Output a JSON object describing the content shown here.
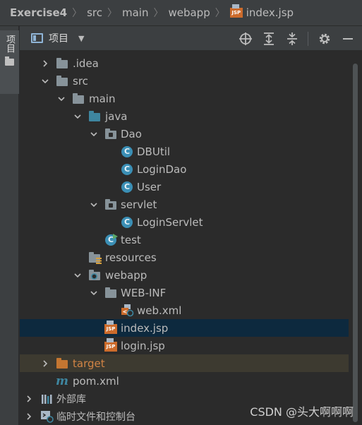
{
  "breadcrumb": {
    "items": [
      "Exercise4",
      "src",
      "main",
      "webapp",
      "index.jsp"
    ],
    "separator": "〉"
  },
  "toolstrip": {
    "tab_label": "项目"
  },
  "panel": {
    "title": "项目",
    "actions": [
      "locate-icon",
      "expand-all-icon",
      "collapse-all-icon",
      "settings-icon",
      "minimize-icon"
    ]
  },
  "tree": {
    "idea": ".idea",
    "src": "src",
    "main": "main",
    "java": "java",
    "dao": "Dao",
    "dbutil": "DBUtil",
    "logindao": "LoginDao",
    "user": "User",
    "servlet": "servlet",
    "loginservlet": "LoginServlet",
    "test": "test",
    "resources": "resources",
    "webapp": "webapp",
    "webinf": "WEB-INF",
    "webxml": "web.xml",
    "indexjsp": "index.jsp",
    "loginjsp": "login.jsp",
    "target": "target",
    "pom": "pom.xml",
    "extlibs": "外部库",
    "scratches": "临时文件和控制台",
    "class_glyph": "C",
    "jsp_glyph": "JSP",
    "maven_glyph": "m"
  },
  "colors": {
    "selection": "#0d293e",
    "excluded": "#3d3a30",
    "source_folder": "#3e86a0",
    "excluded_folder": "#c47631",
    "class_icon": "#3b8fb5"
  },
  "watermark": "CSDN @头大啊啊啊"
}
